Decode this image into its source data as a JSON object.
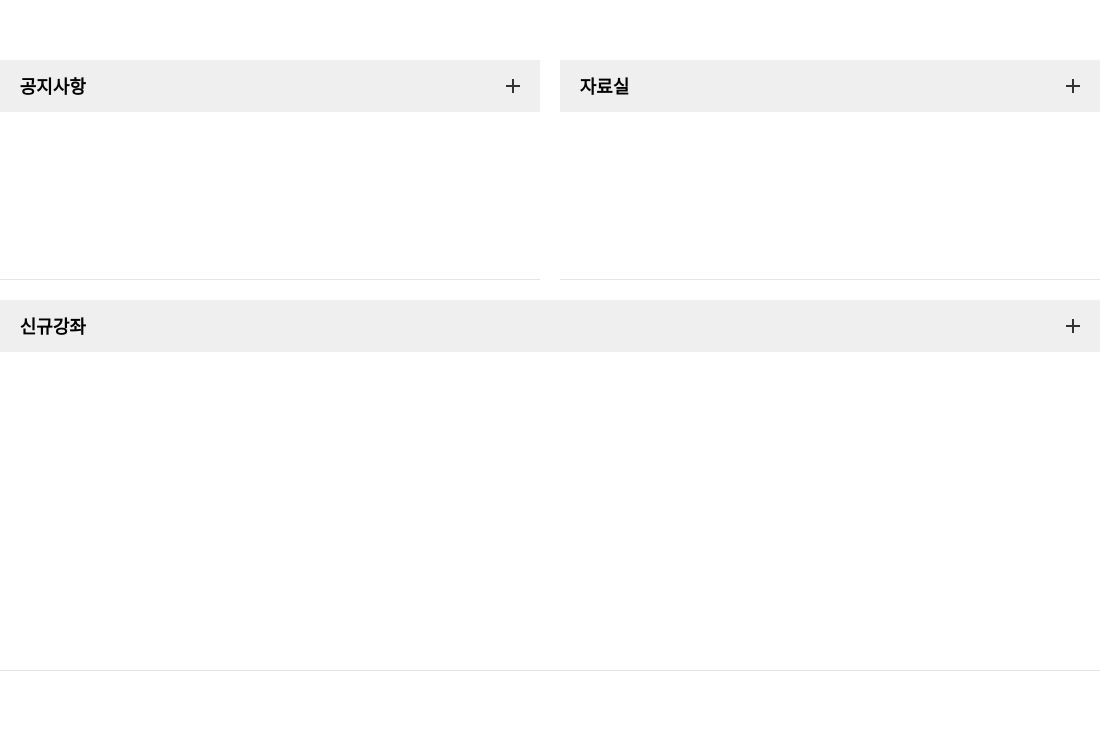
{
  "panels": {
    "notice": {
      "title": "공지사항"
    },
    "archive": {
      "title": "자료실"
    },
    "newCourse": {
      "title": "신규강좌"
    }
  }
}
